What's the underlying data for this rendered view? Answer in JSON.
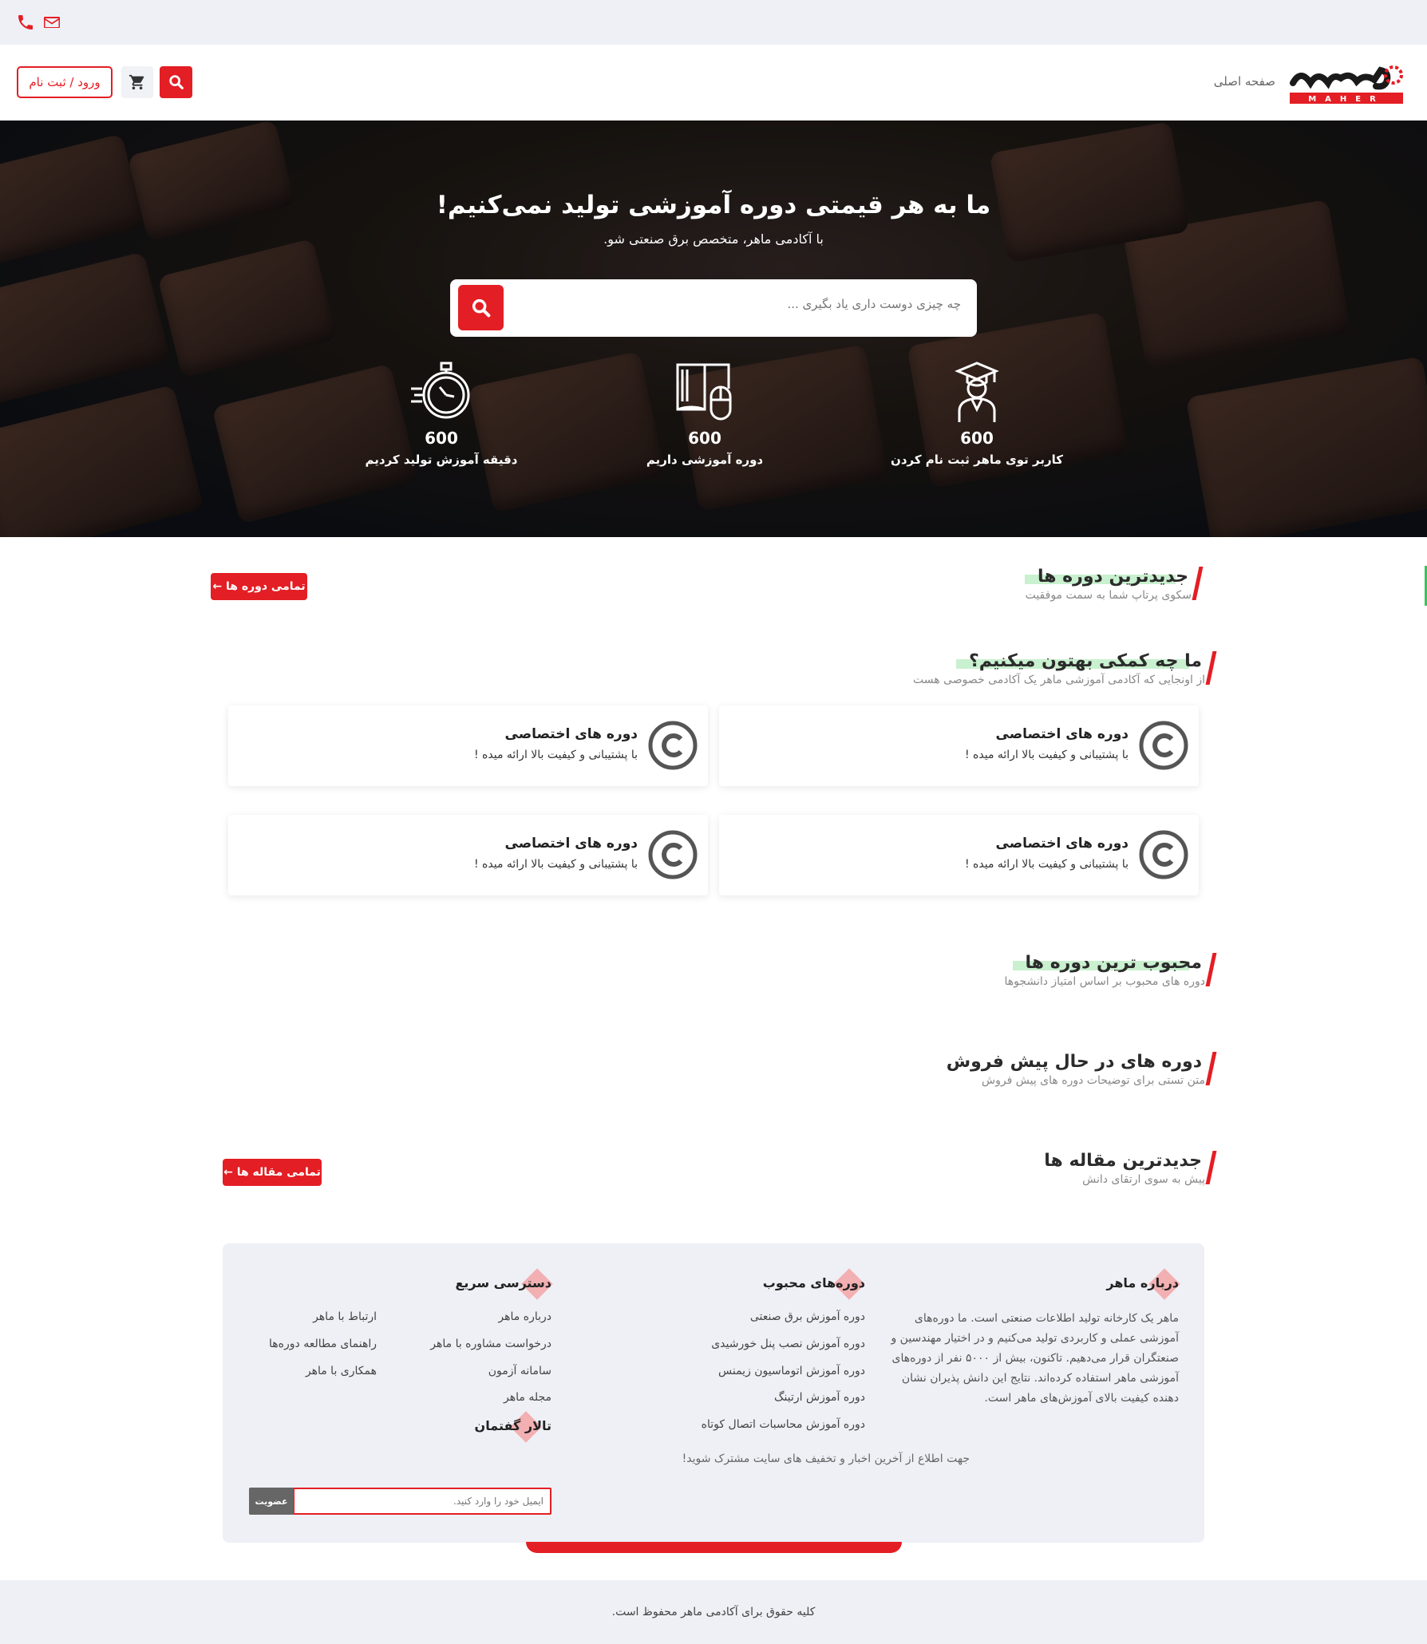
{
  "topbar": {
    "phone_icon": "phone-icon",
    "mail_icon": "mail-icon",
    "accent": "#e31e24"
  },
  "header": {
    "login_label": "ورود / ثبت نام",
    "home_label": "صفحه اصلی",
    "logo_text": "MAHER",
    "cart_icon": "cart-icon",
    "search_icon": "search-icon"
  },
  "hero": {
    "title": "ما به هر قیمتی دوره آموزشی تولید نمی‌کنیم!",
    "subtitle": "با آکادمی ماهر، متخصص برق صنعتی شو.",
    "search_placeholder": "چه چیزی دوست داری یاد بگیری ...",
    "stats": [
      {
        "value": "600",
        "label": "کاربر توی ماهر ثبت نام کردن",
        "icon": "graduate-icon"
      },
      {
        "value": "600",
        "label": "دوره آموزشی داریم",
        "icon": "book-mouse-icon"
      },
      {
        "value": "600",
        "label": "دقیقه آموزش تولید کردیم",
        "icon": "stopwatch-icon"
      }
    ]
  },
  "sections": {
    "newest_courses": {
      "title": "جدیدترین دوره ها",
      "subtitle": "سکوی پرتاپ شما به سمت موفقیت",
      "button": "تمامی دوره ها ←"
    },
    "how_help": {
      "title": "ما چه کمکی بهتون میکنیم؟",
      "subtitle": "از اونجایی که آکادمی آموزشی ماهر یک آکادمی خصوصی هست"
    },
    "popular": {
      "title": "محبوب ترین دوره ها",
      "subtitle": "دوره های محبوب بر اساس امتیاز دانشجوها"
    },
    "presale": {
      "title": "دوره های در حال پیش فروش",
      "subtitle": "متن تستی برای توضیحات دوره های پیش فروش"
    },
    "articles": {
      "title": "جدیدترین مقاله ها",
      "subtitle": "پیش به سوی ارتقای دانش",
      "button": "تمامی مقاله ها ←"
    }
  },
  "features": [
    {
      "title": "دوره های اختصاصی",
      "text": "با پشتیبانی و کیفیت بالا ارائه میده !",
      "icon": "copyright-icon"
    },
    {
      "title": "دوره های اختصاصی",
      "text": "با پشتیبانی و کیفیت بالا ارائه میده !",
      "icon": "copyright-icon"
    },
    {
      "title": "دوره های اختصاصی",
      "text": "با پشتیبانی و کیفیت بالا ارائه میده !",
      "icon": "copyright-icon"
    },
    {
      "title": "دوره های اختصاصی",
      "text": "با پشتیبانی و کیفیت بالا ارائه میده !",
      "icon": "copyright-icon"
    }
  ],
  "footer": {
    "about_title": "درباره ماهر",
    "about_text": "ماهر یک کارخانه تولید اطلاعات صنعتی است. ما دوره‌های آموزشی عملی و کاربردی تولید می‌کنیم و در اختیار مهندسین و صنعتگران قرار می‌دهیم. تاکنون، بیش از ۵۰۰۰ نفر از دوره‌های آموزشی ماهر استفاده کرده‌اند. نتایج این دانش پذیران نشان دهنده کیفیت بالای آموزش‌های ماهر است.",
    "popular_title": "دوره‌های محبوب",
    "popular_links": [
      "دوره آموزش برق صنعتی",
      "دوره آموزش نصب پنل خورشیدی",
      "دوره آموزش اتوماسیون زیمنس",
      "دوره آموزش ارتینگ",
      "دوره آموزش محاسبات اتصال کوتاه"
    ],
    "quick_title": "دسترسی سریع",
    "quick_links_right": [
      "درباره ماهر",
      "درخواست مشاوره با ماهر",
      "سامانه آزمون",
      "مجله ماهر"
    ],
    "quick_links_left": [
      "ارتباط با ماهر",
      "راهنمای مطالعه دوره‌ها",
      "همکاری با ماهر"
    ],
    "forum_title": "تالار گفتمان",
    "newsletter_text": "جهت اطلاع از آخرین اخبار و تخفیف های سایت مشترک شوید!",
    "email_placeholder": "ایمیل خود را وارد کنید.",
    "join_label": "عضویت"
  },
  "copyright": "کلیه حقوق برای آکادمی ماهر محفوظ است."
}
